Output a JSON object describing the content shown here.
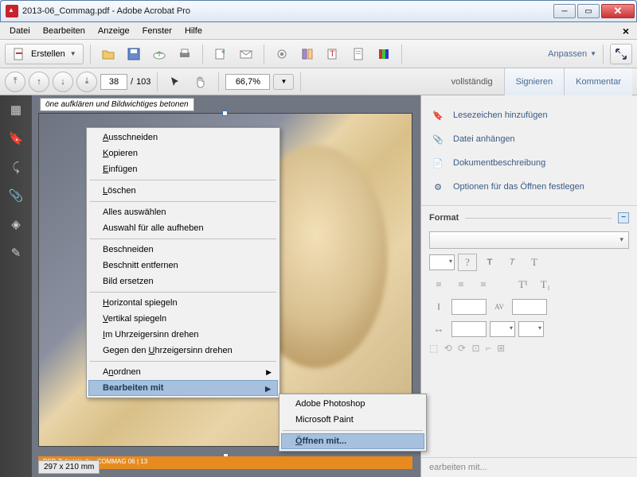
{
  "title": "2013-06_Commag.pdf - Adobe Acrobat Pro",
  "menubar": [
    "Datei",
    "Bearbeiten",
    "Anzeige",
    "Fenster",
    "Hilfe"
  ],
  "toolbar": {
    "create": "Erstellen",
    "anpassen": "Anpassen"
  },
  "nav": {
    "page": "38",
    "total": "103",
    "zoom": "66,7%"
  },
  "tabs": {
    "voll": "vollständig",
    "sign": "Signieren",
    "komm": "Kommentar"
  },
  "doc": {
    "header": "öne aufklären und Bildwichtiges betonen",
    "orange": "PSD-Tutorials.de · COMMAG 06 | 13",
    "dims": "297 x 210 mm"
  },
  "ctx": {
    "cut": "Ausschneiden",
    "copy": "Kopieren",
    "paste": "Einfügen",
    "del": "Löschen",
    "selall": "Alles auswählen",
    "desel": "Auswahl für alle aufheben",
    "crop": "Beschneiden",
    "rmcrop": "Beschnitt entfernen",
    "replace": "Bild ersetzen",
    "fliph": "Horizontal spiegeln",
    "flipv": "Vertikal spiegeln",
    "cw": "Im Uhrzeigersinn drehen",
    "ccw": "Gegen den Uhrzeigersinn drehen",
    "arrange": "Anordnen",
    "editwith": "Bearbeiten mit"
  },
  "sub": {
    "ps": "Adobe Photoshop",
    "paint": "Microsoft Paint",
    "open": "Öffnen mit..."
  },
  "rpanel": {
    "bookmark": "Lesezeichen hinzufügen",
    "attach": "Datei anhängen",
    "desc": "Dokumentbeschreibung",
    "openopt": "Optionen für das Öffnen festlegen",
    "format": "Format",
    "q": "?",
    "foot": "earbeiten mit..."
  }
}
